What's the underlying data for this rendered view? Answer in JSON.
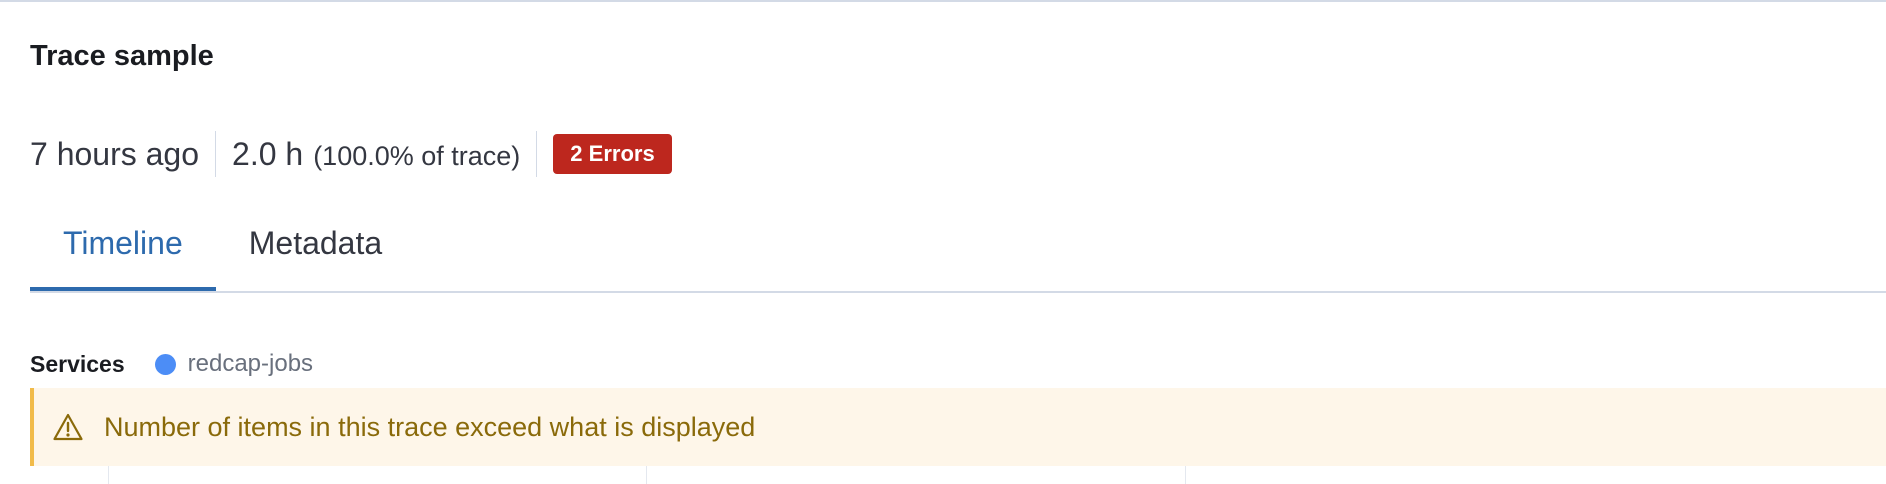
{
  "title": "Trace sample",
  "summary": {
    "age": "7 hours ago",
    "duration": "2.0 h",
    "duration_share": "(100.0% of trace)",
    "errors_badge": "2 Errors"
  },
  "tabs": [
    {
      "label": "Timeline",
      "active": true
    },
    {
      "label": "Metadata",
      "active": false
    }
  ],
  "services": {
    "label": "Services",
    "items": [
      {
        "name": "redcap-jobs",
        "color": "#4c8df6",
        "icon": "service-dot"
      }
    ]
  },
  "callout": {
    "icon": "warning-icon",
    "text": "Number of items in this trace exceed what is displayed"
  },
  "colors": {
    "accent": "#2d6aad",
    "error": "#bd271e",
    "warning_bg": "#fef6e9",
    "warning_border": "#f1bb4a",
    "warning_text": "#8a6a0a"
  }
}
